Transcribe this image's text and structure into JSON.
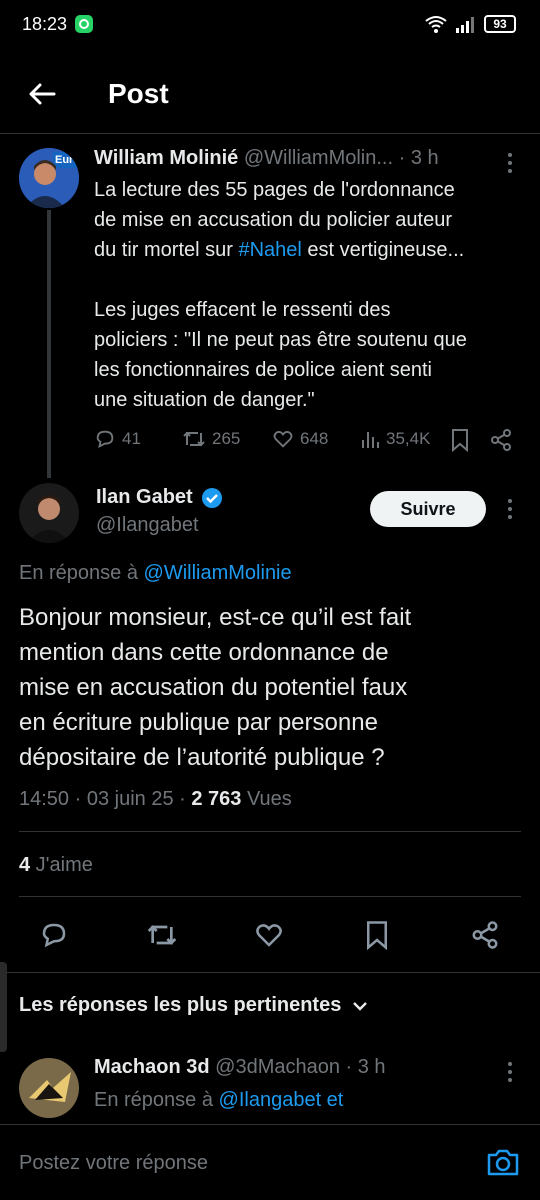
{
  "status": {
    "time": "18:23",
    "battery": "93"
  },
  "header": {
    "title": "Post"
  },
  "quoted": {
    "name": "William Molinié",
    "handle": "@WilliamMolin...",
    "time": "· 3 h",
    "line1": "La lecture des 55 pages de l'ordonnance",
    "line2": "de mise en accusation du policier auteur",
    "line3_pre": "du tir mortel sur ",
    "hashtag": "#Nahel",
    "line3_post": " est vertigineuse...",
    "para2_1": "Les juges effacent le ressenti des",
    "para2_2": "policiers : \"Il ne peut pas être soutenu que",
    "para2_3": "les fonctionnaires de police aient senti",
    "para2_4": "une situation de danger.\"",
    "replies": "41",
    "retweets": "265",
    "likes": "648",
    "views": "35,4K",
    "avatar_label": "Euro"
  },
  "main": {
    "name": "Ilan Gabet",
    "handle": "@Ilangabet",
    "follow": "Suivre",
    "reply_to_prefix": "En réponse à ",
    "reply_to_handle": "@WilliamMolinie",
    "line1": "Bonjour monsieur, est-ce qu’il est fait",
    "line2": "mention dans cette ordonnance de",
    "line3": "mise en accusation du potentiel faux",
    "line4": "en écriture publique par personne",
    "line5": "dépositaire de l’autorité publique ?",
    "meta_time": "14:50 · 03 juin 25 · ",
    "views_count": "2 763",
    "views_label": " Vues",
    "likes_count": "4",
    "likes_label": " J'aime"
  },
  "replies_section": {
    "title": "Les réponses les plus pertinentes"
  },
  "reply": {
    "name": "Machaon 3d",
    "handle": "@3dMachaon",
    "time": "· 3 h",
    "prefix": "En réponse à ",
    "handles": "@Ilangabet et"
  },
  "composer": {
    "placeholder": "Postez votre réponse"
  }
}
